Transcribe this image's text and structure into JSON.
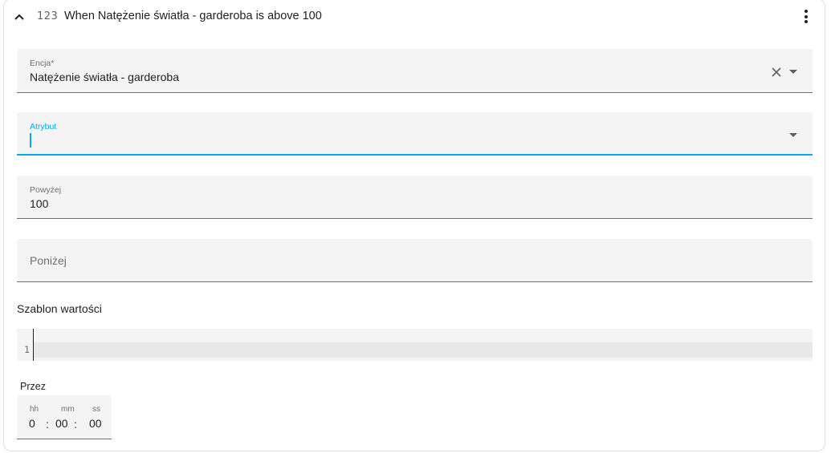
{
  "header": {
    "number_icon_text": "123",
    "title": "When Natężenie światła - garderoba is above 100"
  },
  "fields": {
    "entity": {
      "label": "Encja*",
      "value": "Natężenie światła - garderoba"
    },
    "attribute": {
      "label": "Atrybut",
      "value": ""
    },
    "above": {
      "label": "Powyżej",
      "value": "100"
    },
    "below": {
      "placeholder": "Poniżej"
    }
  },
  "template": {
    "label": "Szablon wartości",
    "line_number": "1"
  },
  "duration": {
    "label": "Przez",
    "hh_label": "hh",
    "mm_label": "mm",
    "ss_label": "ss",
    "hh": "0",
    "mm": "00",
    "ss": "00",
    "sep": ":"
  },
  "colors": {
    "accent": "#03a9f4",
    "field_bg": "#f4f4f4",
    "text": "#212121"
  },
  "icons": [
    "chevron-up-icon",
    "numeric-icon",
    "more-vertical-icon",
    "close-icon",
    "dropdown-arrow-icon"
  ]
}
